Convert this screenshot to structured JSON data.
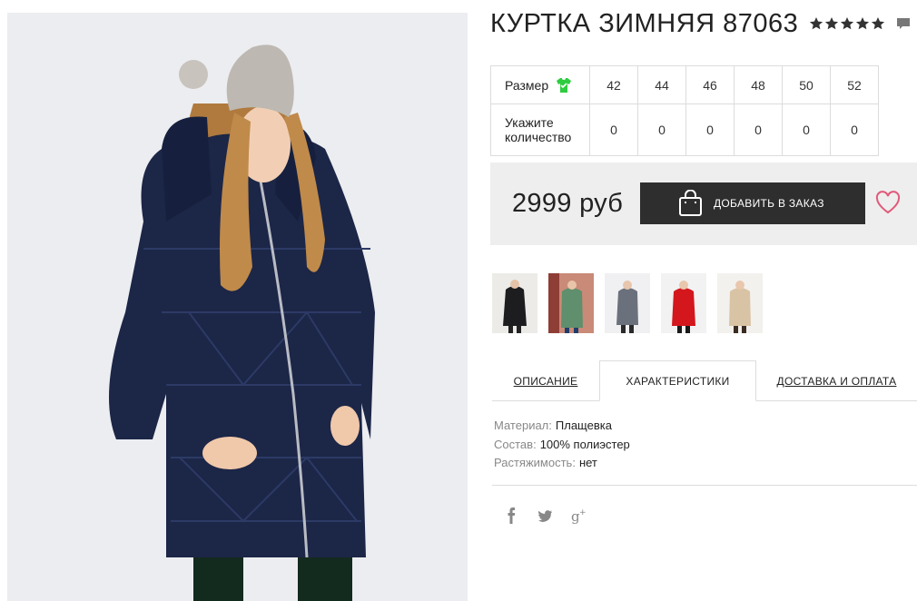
{
  "product": {
    "title": "КУРТКА ЗИМНЯЯ 87063",
    "rating_stars": 5
  },
  "sizes_table": {
    "size_label": "Размер",
    "qty_label": "Укажите количество",
    "sizes": [
      "42",
      "44",
      "46",
      "48",
      "50",
      "52"
    ],
    "quantities": [
      "0",
      "0",
      "0",
      "0",
      "0",
      "0"
    ]
  },
  "purchase": {
    "price": "2999 руб",
    "order_button": "ДОБАВИТЬ В ЗАКАЗ"
  },
  "thumbnails": [
    {
      "icon": "thumbnail-black-jacket"
    },
    {
      "icon": "thumbnail-green-jacket"
    },
    {
      "icon": "thumbnail-grey-jacket"
    },
    {
      "icon": "thumbnail-red-jacket"
    },
    {
      "icon": "thumbnail-beige-jacket"
    }
  ],
  "tabs": [
    {
      "label": "ОПИСАНИЕ",
      "active": false
    },
    {
      "label": "ХАРАКТЕРИСТИКИ",
      "active": true
    },
    {
      "label": "ДОСТАВКА И ОПЛАТА",
      "active": false
    }
  ],
  "characteristics": [
    {
      "key": "Материал:",
      "value": "Плащевка"
    },
    {
      "key": "Состав:",
      "value": "100% полиэстер"
    },
    {
      "key": "Растяжимость:",
      "value": "нет"
    }
  ],
  "social": [
    "facebook-icon",
    "twitter-icon",
    "google-plus-icon"
  ],
  "colors": {
    "button_bg": "#2e2e2e",
    "price_box_bg": "#eeeeee",
    "heart": "#e05a7a",
    "size_icon": "#2ecc40"
  }
}
